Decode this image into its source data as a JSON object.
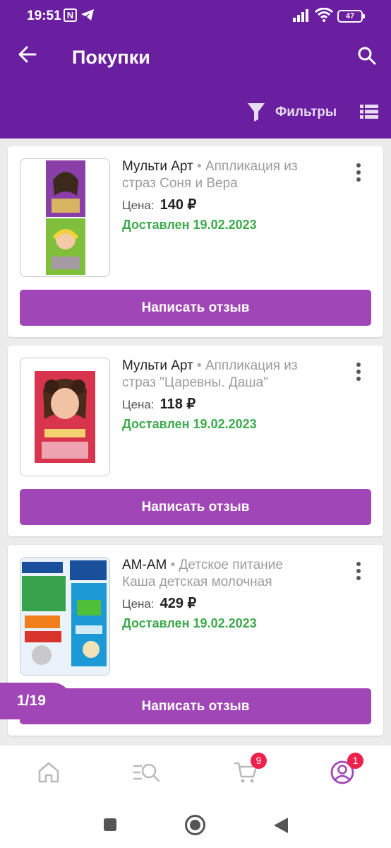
{
  "status_bar": {
    "time": "19:51",
    "battery": "47"
  },
  "app_bar": {
    "title": "Покупки",
    "filter_label": "Фильтры"
  },
  "purchases": [
    {
      "brand": "Мульти Арт",
      "name_part1": "Аппликация из",
      "name_part2": "страз Соня и Вера",
      "price_label": "Цена:",
      "price": "140 ₽",
      "status": "Доставлен 19.02.2023",
      "button": "Написать отзыв",
      "thumb_colors": [
        "#8a3ea8",
        "#7fbf3b"
      ]
    },
    {
      "brand": "Мульти Арт",
      "name_part1": "Аппликация из",
      "name_part2": "страз \"Царевны. Даша\"",
      "price_label": "Цена:",
      "price": "118 ₽",
      "status": "Доставлен 19.02.2023",
      "button": "Написать отзыв",
      "thumb_colors": [
        "#d8344e"
      ]
    },
    {
      "brand": "АМ-АМ",
      "name_part1": "Детское питание",
      "name_part2": "Каша детская молочная",
      "price_label": "Цена:",
      "price": "429 ₽",
      "status": "Доставлен 19.02.2023",
      "button": "Написать отзыв",
      "thumb_colors": [
        "#1d9ad6",
        "#37a34a"
      ]
    }
  ],
  "pager": {
    "label": "1/19"
  },
  "bottom_nav": {
    "cart_badge": "9",
    "profile_badge": "1"
  },
  "colors": {
    "primary": "#6a1fa0",
    "accent": "#a046b6",
    "delivered": "#3daa4c",
    "badge": "#f0204d"
  }
}
